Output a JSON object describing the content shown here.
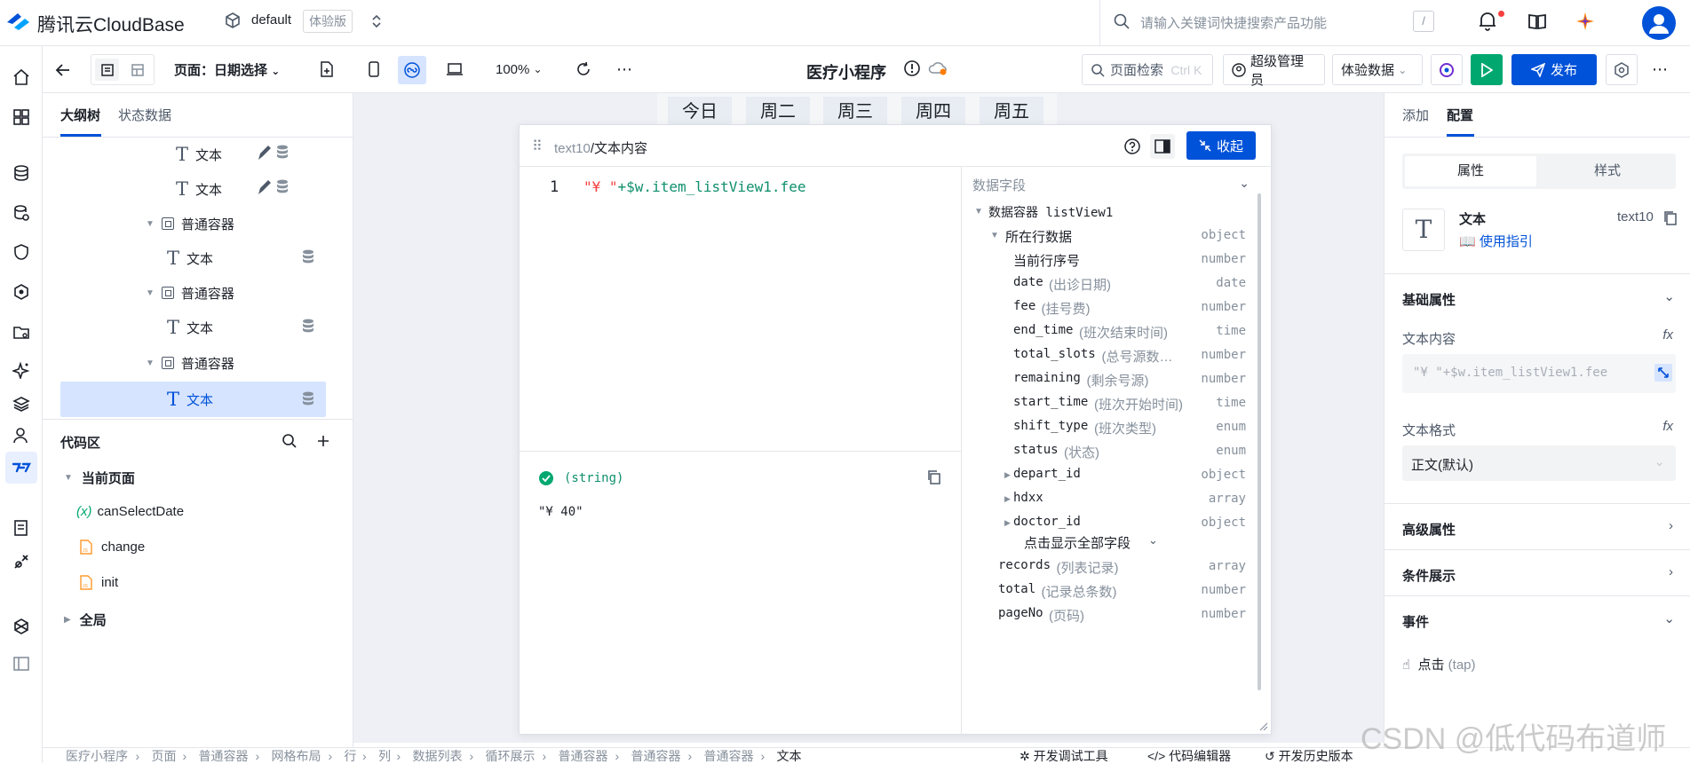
{
  "brand": {
    "name": "腾讯云CloudBase"
  },
  "env": {
    "name": "default",
    "badge": "体验版"
  },
  "search": {
    "placeholder": "请输入关键词快捷搜索产品功能",
    "shortcut": "/"
  },
  "toolbar": {
    "page_label": "页面：日期选择",
    "zoom": "100%",
    "app_title": "医疗小程序",
    "page_search": "页面检索",
    "page_search_shortcut": "Ctrl K",
    "role": "超级管理员",
    "data_mode": "体验数据",
    "publish": "发布"
  },
  "outline": {
    "tab_tree": "大纲树",
    "tab_state": "状态数据",
    "nodes": [
      {
        "label": "文本"
      },
      {
        "label": "文本"
      },
      {
        "label": "普通容器"
      },
      {
        "label": "文本"
      },
      {
        "label": "普通容器"
      },
      {
        "label": "文本"
      },
      {
        "label": "普通容器"
      },
      {
        "label": "文本"
      }
    ]
  },
  "code_area": {
    "title": "代码区",
    "current_page": "当前页面",
    "items": [
      "canSelectDate",
      "change",
      "init"
    ],
    "global": "全局",
    "var_icon": "(x)"
  },
  "canvas": {
    "days": [
      "今日",
      "周二",
      "周三",
      "周四",
      "周五"
    ]
  },
  "editor": {
    "crumb_comp": "text10",
    "crumb_sep": "/",
    "crumb_title": "文本内容",
    "collapse": "收起",
    "line_no": "1",
    "code_str": "\"¥ \"",
    "code_expr": "+$w.item_listView1.fee",
    "result_type": "(string)",
    "result_value": "\"¥ 40\"",
    "fields_title": "数据字段",
    "container": "数据容器 listView1",
    "row_data": "所在行数据",
    "row_data_type": "object",
    "fields": [
      {
        "key": "当前行序号",
        "desc": "",
        "type": "number"
      },
      {
        "key": "date",
        "desc": "(出诊日期)",
        "type": "date"
      },
      {
        "key": "fee",
        "desc": "(挂号费)",
        "type": "number"
      },
      {
        "key": "end_time",
        "desc": "(班次结束时间)",
        "type": "time"
      },
      {
        "key": "total_slots",
        "desc": "(总号源数…",
        "type": "number"
      },
      {
        "key": "remaining",
        "desc": "(剩余号源)",
        "type": "number"
      },
      {
        "key": "start_time",
        "desc": "(班次开始时间)",
        "type": "time"
      },
      {
        "key": "shift_type",
        "desc": "(班次类型)",
        "type": "enum"
      },
      {
        "key": "status",
        "desc": "(状态)",
        "type": "enum"
      },
      {
        "key": "depart_id",
        "desc": "",
        "type": "object"
      },
      {
        "key": "hdxx",
        "desc": "",
        "type": "array"
      },
      {
        "key": "doctor_id",
        "desc": "",
        "type": "object"
      }
    ],
    "show_all": "点击显示全部字段",
    "tail_fields": [
      {
        "key": "records",
        "desc": "(列表记录)",
        "type": "array"
      },
      {
        "key": "total",
        "desc": "(记录总条数)",
        "type": "number"
      },
      {
        "key": "pageNo",
        "desc": "(页码)",
        "type": "number"
      }
    ]
  },
  "right": {
    "tab_add": "添加",
    "tab_config": "配置",
    "seg_props": "属性",
    "seg_style": "样式",
    "comp_name": "文本",
    "comp_id": "text10",
    "guide": "使用指引",
    "basic": "基础属性",
    "text_content": "文本内容",
    "text_value": "\"¥ \"+$w.item_listView1.fee",
    "text_format": "文本格式",
    "format_value": "正文(默认)",
    "advanced": "高级属性",
    "conditional": "条件展示",
    "events": "事件",
    "click": "点击",
    "click_tap": "(tap)",
    "fx": "fx"
  },
  "status": {
    "crumbs": [
      "医疗小程序",
      "页面",
      "普通容器",
      "网格布局",
      "行",
      "列",
      "数据列表",
      "循环展示",
      "普通容器",
      "普通容器",
      "普通容器",
      "文本"
    ],
    "debug": "开发调试工具",
    "code_editor": "代码编辑器",
    "history": "开发历史版本"
  },
  "watermark": "CSDN @低代码布道师",
  "colors": {
    "primary": "#0052d9",
    "green": "#00a870",
    "selected": "#d6e4ff",
    "canvas": "#eef0f5"
  }
}
